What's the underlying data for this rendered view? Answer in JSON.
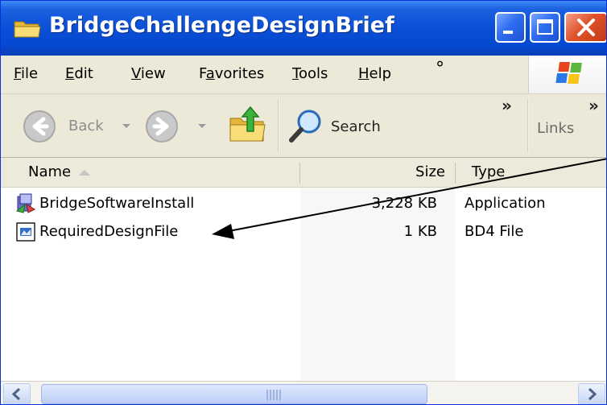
{
  "window": {
    "title": "BridgeChallengeDesignBrief",
    "controls": [
      "minimize",
      "maximize",
      "close"
    ]
  },
  "menubar": {
    "items": [
      {
        "label": "File",
        "accel": "F",
        "rest": "ile"
      },
      {
        "label": "Edit",
        "accel": "E",
        "rest": "dit"
      },
      {
        "label": "View",
        "accel": "V",
        "rest": "iew"
      },
      {
        "label": "Favorites",
        "pre": "F",
        "accel": "a",
        "rest": "vorites"
      },
      {
        "label": "Tools",
        "accel": "T",
        "rest": "ools"
      },
      {
        "label": "Help",
        "accel": "H",
        "rest": "elp"
      }
    ],
    "dot": "°"
  },
  "toolbar": {
    "back_label": "Back",
    "search_label": "Search",
    "more_chevron": "»",
    "links_label": "Links",
    "links_chevron": "»"
  },
  "columns": {
    "name": "Name",
    "size": "Size",
    "type": "Type"
  },
  "files": [
    {
      "name": "BridgeSoftwareInstall",
      "size": "3,228 KB",
      "type": "Application",
      "icon": "installer-icon"
    },
    {
      "name": "RequiredDesignFile",
      "size": "1 KB",
      "type": "BD4 File",
      "icon": "bd4-file-icon"
    }
  ],
  "colors": {
    "titlebar_blue": "#0a4fd6",
    "close_red": "#e0522b",
    "annotation_arrow": "#000000"
  }
}
